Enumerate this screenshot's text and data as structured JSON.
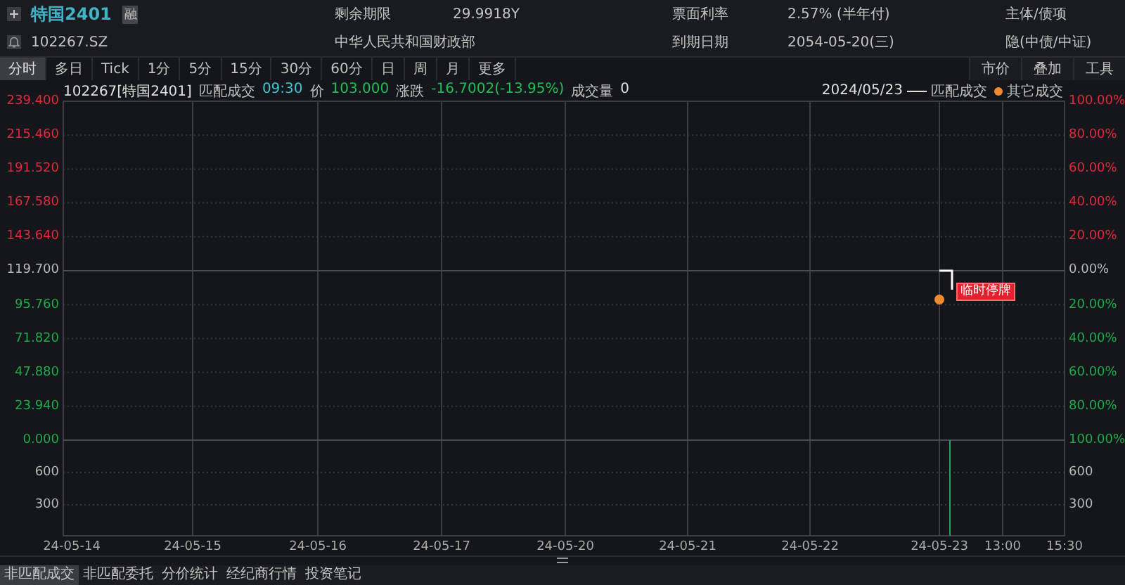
{
  "security": {
    "name": "特国2401",
    "tag": "融",
    "code": "102267.SZ"
  },
  "info": {
    "remaining_term_label": "剩余期限",
    "remaining_term": "29.9918Y",
    "coupon_label": "票面利率",
    "coupon": "2.57% (半年付)",
    "rating_label": "主体/债项",
    "issuer": "中华人民共和国财政部",
    "maturity_label": "到期日期",
    "maturity": "2054-05-20(三)",
    "implied_rating": "隐(中债/中证)"
  },
  "periods": [
    {
      "label": "分时",
      "selected": true
    },
    {
      "label": "多日",
      "selected": false
    },
    {
      "label": "Tick",
      "selected": false
    },
    {
      "label": "1分",
      "selected": false
    },
    {
      "label": "5分",
      "selected": false
    },
    {
      "label": "15分",
      "selected": false
    },
    {
      "label": "30分",
      "selected": false
    },
    {
      "label": "60分",
      "selected": false
    },
    {
      "label": "日",
      "selected": false
    },
    {
      "label": "周",
      "selected": false
    },
    {
      "label": "月",
      "selected": false
    },
    {
      "label": "更多",
      "selected": false
    }
  ],
  "tools": [
    "市价",
    "叠加",
    "工具"
  ],
  "quote": {
    "security": "102267[特国2401]",
    "type_label": "匹配成交",
    "time": "09:30",
    "price_label": "价",
    "price": "103.000",
    "change_label": "涨跌",
    "change": "-16.7002(-13.95%)",
    "volume_label": "成交量",
    "volume": "0"
  },
  "legend": {
    "date": "2024/05/23",
    "line_label": "匹配成交",
    "dot_label": "其它成交"
  },
  "left_axis": [
    {
      "label": "239.400",
      "kind": "up"
    },
    {
      "label": "215.460",
      "kind": "up"
    },
    {
      "label": "191.520",
      "kind": "up"
    },
    {
      "label": "167.580",
      "kind": "up"
    },
    {
      "label": "143.640",
      "kind": "up"
    },
    {
      "label": "119.700",
      "kind": "flat"
    },
    {
      "label": "95.760",
      "kind": "down"
    },
    {
      "label": "71.820",
      "kind": "down"
    },
    {
      "label": "47.880",
      "kind": "down"
    },
    {
      "label": "23.940",
      "kind": "down"
    },
    {
      "label": "0.000",
      "kind": "down"
    },
    {
      "label": "600",
      "kind": "volume"
    },
    {
      "label": "300",
      "kind": "volume"
    }
  ],
  "right_axis": [
    {
      "label": "100.00%",
      "kind": "up"
    },
    {
      "label": "80.00%",
      "kind": "up"
    },
    {
      "label": "60.00%",
      "kind": "up"
    },
    {
      "label": "40.00%",
      "kind": "up"
    },
    {
      "label": "20.00%",
      "kind": "up"
    },
    {
      "label": "0.00%",
      "kind": "flat"
    },
    {
      "label": "20.00%",
      "kind": "down"
    },
    {
      "label": "40.00%",
      "kind": "down"
    },
    {
      "label": "60.00%",
      "kind": "down"
    },
    {
      "label": "80.00%",
      "kind": "down"
    },
    {
      "label": "100.00%",
      "kind": "down"
    },
    {
      "label": "600",
      "kind": "volume"
    },
    {
      "label": "300",
      "kind": "volume"
    }
  ],
  "x_axis": [
    "24-05-14",
    "24-05-15",
    "24-05-16",
    "24-05-17",
    "24-05-20",
    "24-05-21",
    "24-05-22",
    "24-05-23",
    "13:00",
    "15:30"
  ],
  "marker": {
    "label": "临时停牌"
  },
  "bottom_tabs": [
    {
      "label": "非匹配成交",
      "selected": true
    },
    {
      "label": "非匹配委托",
      "selected": false
    },
    {
      "label": "分价统计",
      "selected": false
    },
    {
      "label": "经纪商行情",
      "selected": false
    },
    {
      "label": "投资笔记",
      "selected": false
    }
  ]
}
